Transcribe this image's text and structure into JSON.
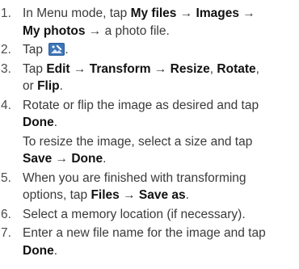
{
  "steps": [
    {
      "number": "1.",
      "text_1": "In Menu mode, tap ",
      "bold_1": "My files",
      "arrow_1": " → ",
      "bold_2": "Images",
      "arrow_2": " →",
      "bold_3": "My photos",
      "text_2": " → a photo file."
    },
    {
      "number": "2.",
      "text_1": "Tap ",
      "icon": "edit-image-icon",
      "text_2": "."
    },
    {
      "number": "3.",
      "text_1": "Tap ",
      "bold_1": "Edit",
      "arrow_1": " → ",
      "bold_2": "Transform",
      "arrow_2": " → ",
      "bold_3": "Resize",
      "sep_1": ", ",
      "bold_4": "Rotate",
      "sep_2": ",",
      "text_2": "or ",
      "bold_5": "Flip",
      "text_3": "."
    },
    {
      "number": "4.",
      "text_1": "Rotate or flip the image as desired and tap",
      "bold_1": "Done",
      "text_2": ".",
      "sub_text": "To resize the image, select a size and tap",
      "sub_bold_1": "Save",
      "sub_arrow": " → ",
      "sub_bold_2": "Done",
      "sub_end": "."
    },
    {
      "number": "5.",
      "text_1": "When you are finished with transforming",
      "text_2": "options, tap ",
      "bold_1": "Files",
      "arrow_1": " → ",
      "bold_2": "Save as",
      "text_3": "."
    },
    {
      "number": "6.",
      "text_1": "Select a memory location (if necessary)."
    },
    {
      "number": "7.",
      "text_1": "Enter a new file name for the image and tap",
      "bold_1": "Done",
      "text_2": "."
    }
  ],
  "colors": {
    "text": "#3a3a3a",
    "bold": "#111111",
    "icon_bg": "#2f5f9a"
  }
}
